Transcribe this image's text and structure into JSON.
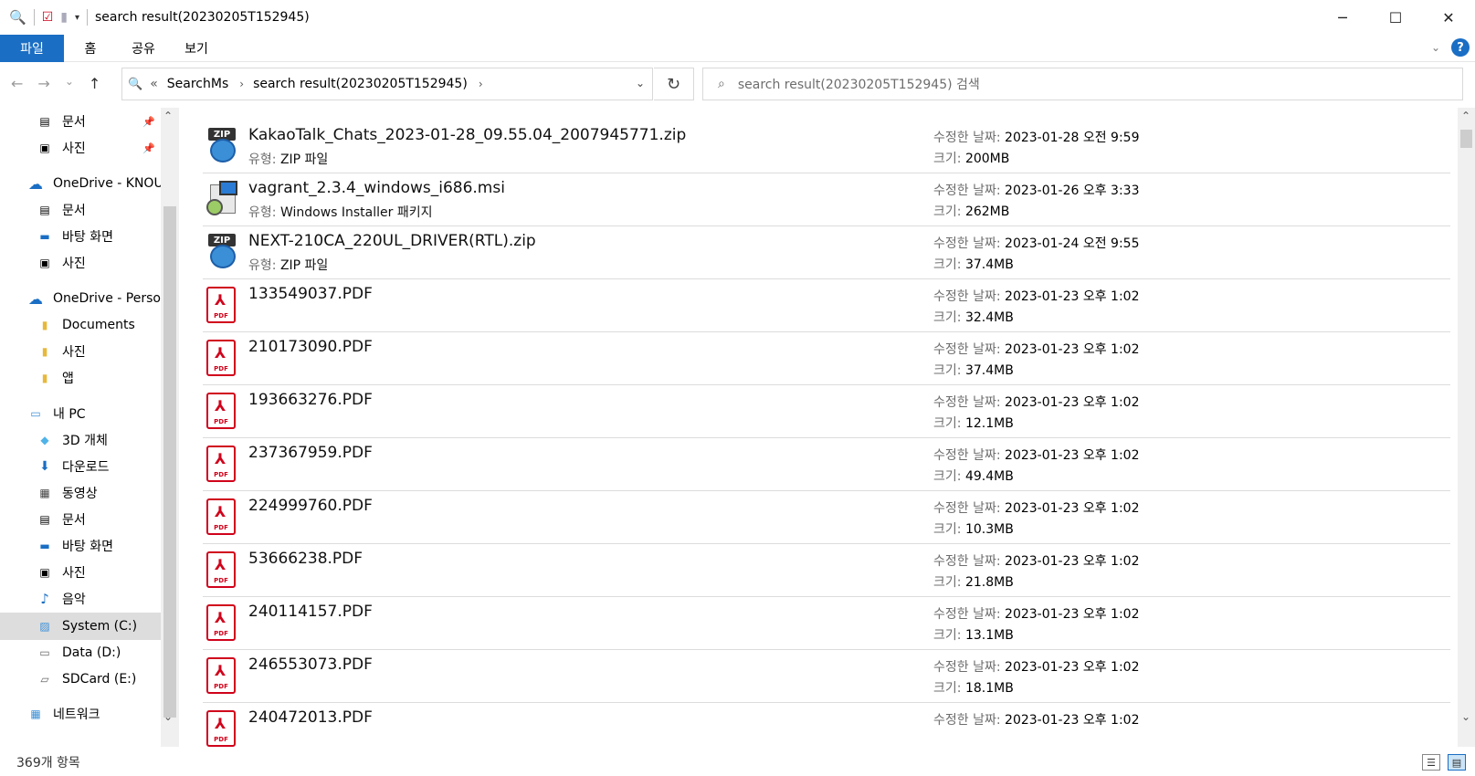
{
  "window": {
    "title": "search result(20230205T152945)",
    "minimize_glyph": "─",
    "maximize_glyph": "☐",
    "close_glyph": "✕"
  },
  "ribbon": {
    "tabs": [
      "파일",
      "홈",
      "공유",
      "보기"
    ],
    "help_label": "?"
  },
  "address": {
    "back_glyph": "←",
    "forward_glyph": "→",
    "recent_glyph": "⌄",
    "up_glyph": "↑",
    "prefix": "«",
    "crumbs": [
      "SearchMs",
      "search result(20230205T152945)"
    ],
    "separator": "›",
    "dropdown_glyph": "⌄",
    "refresh_glyph": "↻"
  },
  "search": {
    "placeholder": "search result(20230205T152945) 검색",
    "icon_glyph": "⌕"
  },
  "sidebar": {
    "items": [
      {
        "label": "문서",
        "icon": "document-icon",
        "pinned": true
      },
      {
        "label": "사진",
        "icon": "picture-icon",
        "pinned": true
      },
      {
        "label": "OneDrive - KNOU",
        "icon": "onedrive-icon"
      },
      {
        "label": "문서",
        "icon": "document-icon"
      },
      {
        "label": "바탕 화면",
        "icon": "desktop-icon"
      },
      {
        "label": "사진",
        "icon": "picture-icon"
      },
      {
        "label": "OneDrive - Personal",
        "icon": "onedrive-icon"
      },
      {
        "label": "Documents",
        "icon": "folder-icon"
      },
      {
        "label": "사진",
        "icon": "folder-icon"
      },
      {
        "label": "앱",
        "icon": "folder-icon"
      },
      {
        "label": "내 PC",
        "icon": "pc-icon"
      },
      {
        "label": "3D 개체",
        "icon": "3d-objects-icon"
      },
      {
        "label": "다운로드",
        "icon": "download-icon"
      },
      {
        "label": "동영상",
        "icon": "video-icon"
      },
      {
        "label": "문서",
        "icon": "document-icon"
      },
      {
        "label": "바탕 화면",
        "icon": "desktop-icon"
      },
      {
        "label": "사진",
        "icon": "picture-icon"
      },
      {
        "label": "음악",
        "icon": "music-icon"
      },
      {
        "label": "System (C:)",
        "icon": "system-drive-icon",
        "selected": true
      },
      {
        "label": "Data (D:)",
        "icon": "drive-icon"
      },
      {
        "label": "SDCard (E:)",
        "icon": "removable-drive-icon"
      },
      {
        "label": "네트워크",
        "icon": "network-icon"
      }
    ],
    "pin_glyph": "📌"
  },
  "files": {
    "type_label": "유형:",
    "date_label": "수정한 날짜:",
    "size_label": "크기:",
    "items": [
      {
        "name": "KakaoTalk_Chats_2023-01-28_09.55.04_2007945771.zip",
        "type": "ZIP 파일",
        "date": "2023-01-28 오전 9:59",
        "size": "200MB",
        "icon": "zip-icon"
      },
      {
        "name": "vagrant_2.3.4_windows_i686.msi",
        "type": "Windows Installer 패키지",
        "date": "2023-01-26 오후 3:33",
        "size": "262MB",
        "icon": "msi-icon"
      },
      {
        "name": "NEXT-210CA_220UL_DRIVER(RTL).zip",
        "type": "ZIP 파일",
        "date": "2023-01-24 오전 9:55",
        "size": "37.4MB",
        "icon": "zip-icon"
      },
      {
        "name": "133549037.PDF",
        "type": "",
        "date": "2023-01-23 오후 1:02",
        "size": "32.4MB",
        "icon": "pdf-icon"
      },
      {
        "name": "210173090.PDF",
        "type": "",
        "date": "2023-01-23 오후 1:02",
        "size": "37.4MB",
        "icon": "pdf-icon"
      },
      {
        "name": "193663276.PDF",
        "type": "",
        "date": "2023-01-23 오후 1:02",
        "size": "12.1MB",
        "icon": "pdf-icon"
      },
      {
        "name": "237367959.PDF",
        "type": "",
        "date": "2023-01-23 오후 1:02",
        "size": "49.4MB",
        "icon": "pdf-icon"
      },
      {
        "name": "224999760.PDF",
        "type": "",
        "date": "2023-01-23 오후 1:02",
        "size": "10.3MB",
        "icon": "pdf-icon"
      },
      {
        "name": "53666238.PDF",
        "type": "",
        "date": "2023-01-23 오후 1:02",
        "size": "21.8MB",
        "icon": "pdf-icon"
      },
      {
        "name": "240114157.PDF",
        "type": "",
        "date": "2023-01-23 오후 1:02",
        "size": "13.1MB",
        "icon": "pdf-icon"
      },
      {
        "name": "246553073.PDF",
        "type": "",
        "date": "2023-01-23 오후 1:02",
        "size": "18.1MB",
        "icon": "pdf-icon"
      },
      {
        "name": "240472013.PDF",
        "type": "",
        "date": "2023-01-23 오후 1:02",
        "size": "",
        "icon": "pdf-icon"
      }
    ]
  },
  "status": {
    "count": "369개 항목"
  },
  "colors": {
    "accent": "#1a6ec4",
    "selected": "#dddddd",
    "pdf_red": "#d0021b"
  }
}
